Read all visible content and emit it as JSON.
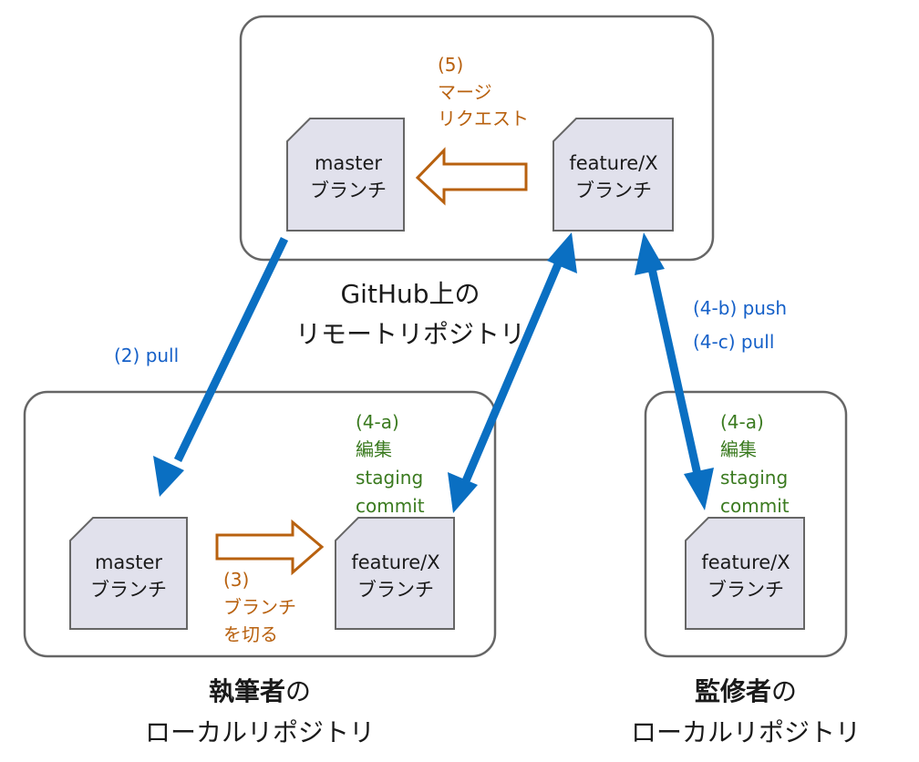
{
  "github": {
    "title_line1": "GitHub上の",
    "title_line2": "リモートリポジトリ",
    "master": {
      "line1": "master",
      "line2": "ブランチ"
    },
    "feature": {
      "line1": "feature/X",
      "line2": "ブランチ"
    },
    "merge_step": [
      "(5)",
      "マージ",
      "リクエスト"
    ]
  },
  "writer": {
    "title_bold": "執筆者",
    "title_suffix": "の",
    "title_line2": "ローカルリポジトリ",
    "master": {
      "line1": "master",
      "line2": "ブランチ"
    },
    "feature": {
      "line1": "feature/X",
      "line2": "ブランチ"
    },
    "branch_step": [
      "(3)",
      "ブランチ",
      "を切る"
    ],
    "edit_step": [
      "(4-a)",
      "編集",
      "staging",
      "commit"
    ]
  },
  "reviewer": {
    "title_bold": "監修者",
    "title_suffix": "の",
    "title_line2": "ローカルリポジトリ",
    "feature": {
      "line1": "feature/X",
      "line2": "ブランチ"
    },
    "edit_step": [
      "(4-a)",
      "編集",
      "staging",
      "commit"
    ]
  },
  "arrows": {
    "pull_label": "(2) pull",
    "push_label": "(4-b) push",
    "pull2_label": "(4-c) pull"
  },
  "colors": {
    "blue": "#0a6fc2",
    "orange": "#b8610f",
    "green": "#3a7a1f"
  }
}
